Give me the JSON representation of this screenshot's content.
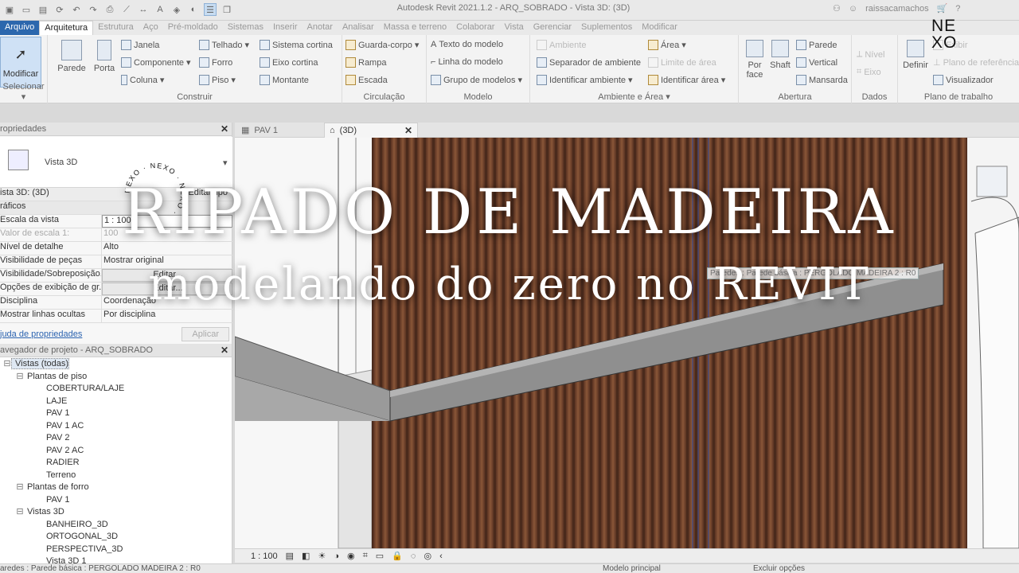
{
  "window": {
    "title": "Autodesk Revit 2021.1.2 - ARQ_SOBRADO - Vista 3D: (3D)",
    "username": "raissacamachos"
  },
  "ribbon_tabs": [
    "Arquivo",
    "Arquitetura",
    "Estrutura",
    "Aço",
    "Pré-moldado",
    "Sistemas",
    "Inserir",
    "Anotar",
    "Analisar",
    "Massa e terreno",
    "Colaborar",
    "Vista",
    "Gerenciar",
    "Suplementos",
    "Modificar"
  ],
  "ribbon": {
    "select": {
      "modify": "Modificar",
      "group": "Selecionar"
    },
    "build": {
      "wall": "Parede",
      "door": "Porta",
      "window": "Janela",
      "component": "Componente",
      "column": "Coluna",
      "roof": "Telhado",
      "ceiling": "Forro",
      "floor": "Piso",
      "curtain_system": "Sistema  cortina",
      "curtain_grid": "Eixo  cortina",
      "mullion": "Montante",
      "group": "Construir"
    },
    "circulation": {
      "railing": "Guarda-corpo",
      "ramp": "Rampa",
      "stair": "Escada",
      "group": "Circulação"
    },
    "model": {
      "model_text": "Texto  do  modelo",
      "model_line": "Linha  do  modelo",
      "model_group": "Grupo  de  modelos",
      "group": "Modelo"
    },
    "room": {
      "room": "Ambiente",
      "room_separator": "Separador  de  ambiente",
      "tag_room": "Identificar  ambiente",
      "area": "Área",
      "area_boundary": "Limite  de  área",
      "tag_area": "Identificar  área",
      "group": "Ambiente e Área"
    },
    "opening": {
      "by_face": "Por\nface",
      "by_face_1": "Por",
      "by_face_2": "face",
      "shaft": "Shaft",
      "wall": "Parede",
      "vertical": "Vertical",
      "dormer": "Mansarda",
      "group": "Abertura"
    },
    "datum": {
      "level": "Nível",
      "grid": "Eixo",
      "group": "Dados"
    },
    "workplane": {
      "set": "Definir",
      "show": "Exibir",
      "ref_plane": "Plano  de  referência",
      "viewer": "Visualizador",
      "group": "Plano de trabalho"
    }
  },
  "properties": {
    "header": "ropriedades",
    "type_name": "Vista 3D",
    "instance": "ista 3D: (3D)",
    "edit_type": "Editar tipo",
    "section": "ráficos",
    "rows": [
      {
        "k": "Escala da vista",
        "v": "1 : 100"
      },
      {
        "k": "Valor de escala    1:",
        "v": "100"
      },
      {
        "k": "Nível de detalhe",
        "v": "Alto"
      },
      {
        "k": "Visibilidade de peças",
        "v": "Mostrar original"
      },
      {
        "k": "Visibilidade/Sobreposição...",
        "v": "Editar..."
      },
      {
        "k": "Opções de exibição de gr...",
        "v": "Editar..."
      },
      {
        "k": "Disciplina",
        "v": "Coordenação"
      },
      {
        "k": "Mostrar linhas ocultas",
        "v": "Por disciplina"
      }
    ],
    "help_link": "juda de propriedades",
    "apply": "Aplicar"
  },
  "browser": {
    "header": "avegador de projeto - ARQ_SOBRADO",
    "tree": [
      {
        "label": "Vistas (todas)",
        "level": 0,
        "twisty": "−",
        "selected": true
      },
      {
        "label": "Plantas de piso",
        "level": 1,
        "twisty": "−"
      },
      {
        "label": "COBERTURA/LAJE",
        "level": 2,
        "twisty": ""
      },
      {
        "label": "LAJE",
        "level": 2,
        "twisty": ""
      },
      {
        "label": "PAV 1",
        "level": 2,
        "twisty": ""
      },
      {
        "label": "PAV 1 AC",
        "level": 2,
        "twisty": ""
      },
      {
        "label": "PAV 2",
        "level": 2,
        "twisty": ""
      },
      {
        "label": "PAV 2 AC",
        "level": 2,
        "twisty": ""
      },
      {
        "label": "RADIER",
        "level": 2,
        "twisty": ""
      },
      {
        "label": "Terreno",
        "level": 2,
        "twisty": ""
      },
      {
        "label": "Plantas de forro",
        "level": 1,
        "twisty": "−"
      },
      {
        "label": "PAV 1",
        "level": 2,
        "twisty": ""
      },
      {
        "label": "Vistas 3D",
        "level": 1,
        "twisty": "−"
      },
      {
        "label": "BANHEIRO_3D",
        "level": 2,
        "twisty": ""
      },
      {
        "label": "ORTOGONAL_3D",
        "level": 2,
        "twisty": ""
      },
      {
        "label": "PERSPECTIVA_3D",
        "level": 2,
        "twisty": ""
      },
      {
        "label": "Vista 3D 1",
        "level": 2,
        "twisty": ""
      }
    ]
  },
  "view_tabs": [
    {
      "label": "PAV 1"
    },
    {
      "label": "(3D)",
      "active": true
    }
  ],
  "view": {
    "tooltip": "Paredes : Parede básica : PERGOLADO MADEIRA 2 : R0",
    "scale": "1 : 100"
  },
  "statusbar": {
    "left": "aredes : Parede básica : PERGOLADO MADEIRA 2 : R0",
    "model": "Modelo principal",
    "exclude": "Excluir opções"
  },
  "overlay": {
    "title": "RIPADO DE MADEIRA",
    "subtitle": "modelando do zero no REVIT",
    "logo_top": "NE",
    "logo_bottom": "XO",
    "seal_text": "NEXO · NEXO · NEXO ·"
  },
  "colors": {
    "file_tab": "#2c67ad",
    "wood": "#7a4a33",
    "selection": "#cfe1f5"
  }
}
